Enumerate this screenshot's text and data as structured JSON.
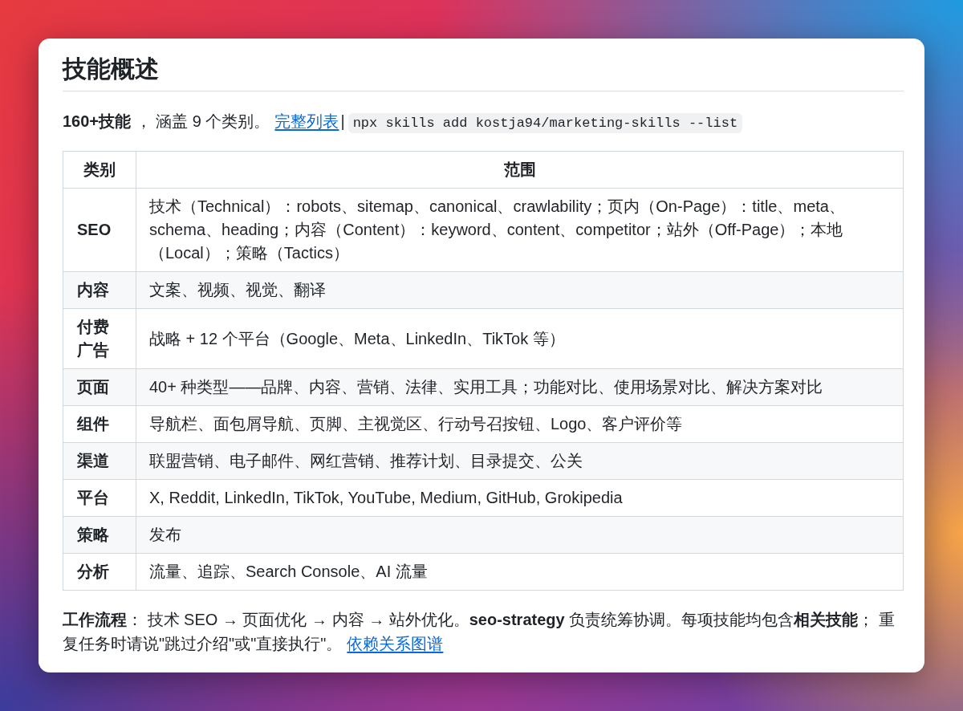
{
  "heading": "技能概述",
  "intro": {
    "text": "**160+技能** ， 涵盖 9 个类别。",
    "link": "完整列表",
    "separator": "|",
    "code": "npx skills add kostja94/marketing-skills --list"
  },
  "table": {
    "columns": [
      "类别",
      "范围"
    ],
    "rows": [
      {
        "category": "SEO",
        "scope": "技术（Technical）：robots、sitemap、canonical、crawlability；页内（On-Page）：title、meta、schema、heading；内容（Content）：keyword、content、competitor；站外（Off-Page）；本地（Local）；策略（Tactics）"
      },
      {
        "category": "内容",
        "scope": "文案、视频、视觉、翻译"
      },
      {
        "category": "付费广告",
        "scope": "战略 + 12 个平台（Google、Meta、LinkedIn、TikTok 等）"
      },
      {
        "category": "页面",
        "scope": "40+ 种类型——品牌、内容、营销、法律、实用工具；功能对比、使用场景对比、解决方案对比"
      },
      {
        "category": "组件",
        "scope": "导航栏、面包屑导航、页脚、主视觉区、行动号召按钮、Logo、客户评价等"
      },
      {
        "category": "渠道",
        "scope": "联盟营销、电子邮件、网红营销、推荐计划、目录提交、公关"
      },
      {
        "category": "平台",
        "scope": "X, Reddit, LinkedIn, TikTok, YouTube, Medium, GitHub, Grokipedia"
      },
      {
        "category": "策略",
        "scope": "发布"
      },
      {
        "category": "分析",
        "scope": "流量、追踪、Search Console、AI 流量"
      }
    ]
  },
  "footer": {
    "text": "**工作流程**： 技术 SEO → 页面优化 → 内容 → 站外优化。**seo-strategy** 负责统筹协调。每项技能均包含**相关技能**； 重复任务时请说\"跳过介绍\"或\"直接执行\"。",
    "link": "依赖关系图谱"
  }
}
